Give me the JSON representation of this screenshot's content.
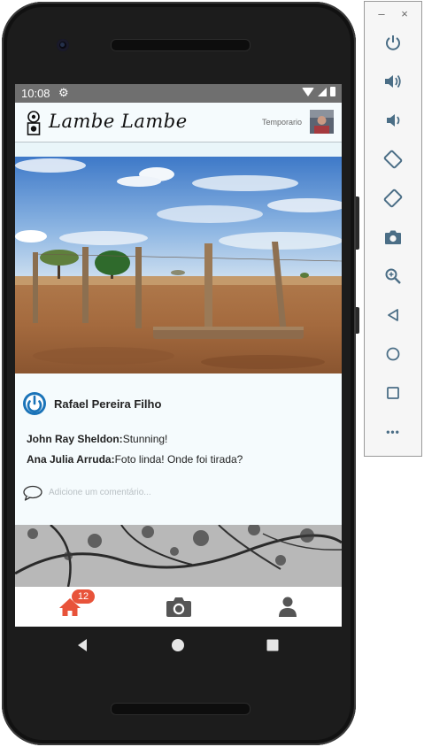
{
  "status_bar": {
    "time": "10:08"
  },
  "app": {
    "title": "Lambe Lambe",
    "user_name": "Temporario"
  },
  "post": {
    "author": "Rafael Pereira Filho",
    "comments": [
      {
        "user": "John Ray Sheldon:",
        "text": "Stunning!"
      },
      {
        "user": "Ana Julia Arruda:",
        "text": "Foto linda! Onde foi tirada?"
      }
    ],
    "comment_placeholder": "Adicione um comentário..."
  },
  "tabbar": {
    "items": [
      {
        "name": "home",
        "icon": "home-icon",
        "badge": "12",
        "active_color": "#e8533a"
      },
      {
        "name": "camera",
        "icon": "camera-icon"
      },
      {
        "name": "profile",
        "icon": "user-icon"
      }
    ]
  },
  "android_nav": {
    "icons": [
      "back-icon",
      "home-circle-icon",
      "recents-icon"
    ]
  },
  "emulator_panel": {
    "window_controls": {
      "minimize": "–",
      "close": "×"
    },
    "buttons": [
      "power-icon",
      "volume-up-icon",
      "volume-down-icon",
      "rotate-left-icon",
      "rotate-right-icon",
      "screenshot-icon",
      "zoom-icon",
      "back-icon",
      "home-icon",
      "overview-icon",
      "more-icon"
    ],
    "more_label": "•••"
  },
  "colors": {
    "accent": "#e8533a",
    "header_bg": "#f5fbfd",
    "status_bar": "#6f6f6f",
    "icon_blue": "#1a73b8"
  }
}
